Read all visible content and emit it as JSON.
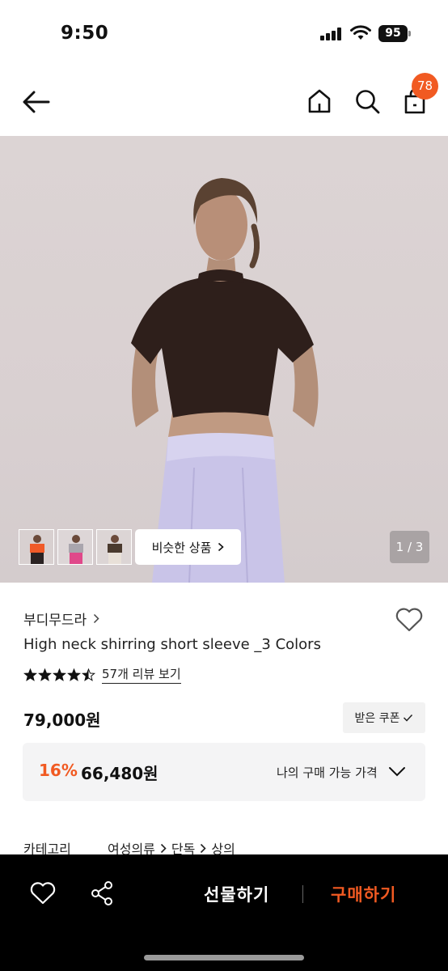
{
  "status": {
    "time": "9:50",
    "battery": "95"
  },
  "header": {
    "cart_count": "78"
  },
  "gallery": {
    "similar_label": "비슷한 상품",
    "page_indicator": "1 / 3"
  },
  "product": {
    "brand": "부디무드라",
    "title": "High neck shirring short sleeve _3 Colors",
    "rating": 4.5,
    "review_link": "57개 리뷰 보기",
    "price": "79,000원",
    "coupon_label": "받은 쿠폰",
    "discount_percent": "16%",
    "discount_price": "66,480원",
    "my_price_label": "나의 구매 가능 가격"
  },
  "category": {
    "label": "카테고리",
    "path": [
      "여성의류",
      "단독",
      "상의"
    ]
  },
  "bottom_bar": {
    "gift_label": "선물하기",
    "buy_label": "구매하기"
  },
  "colors": {
    "accent": "#f15a22",
    "badge": "#f15a22",
    "bottom_bar_bg": "#000000"
  }
}
